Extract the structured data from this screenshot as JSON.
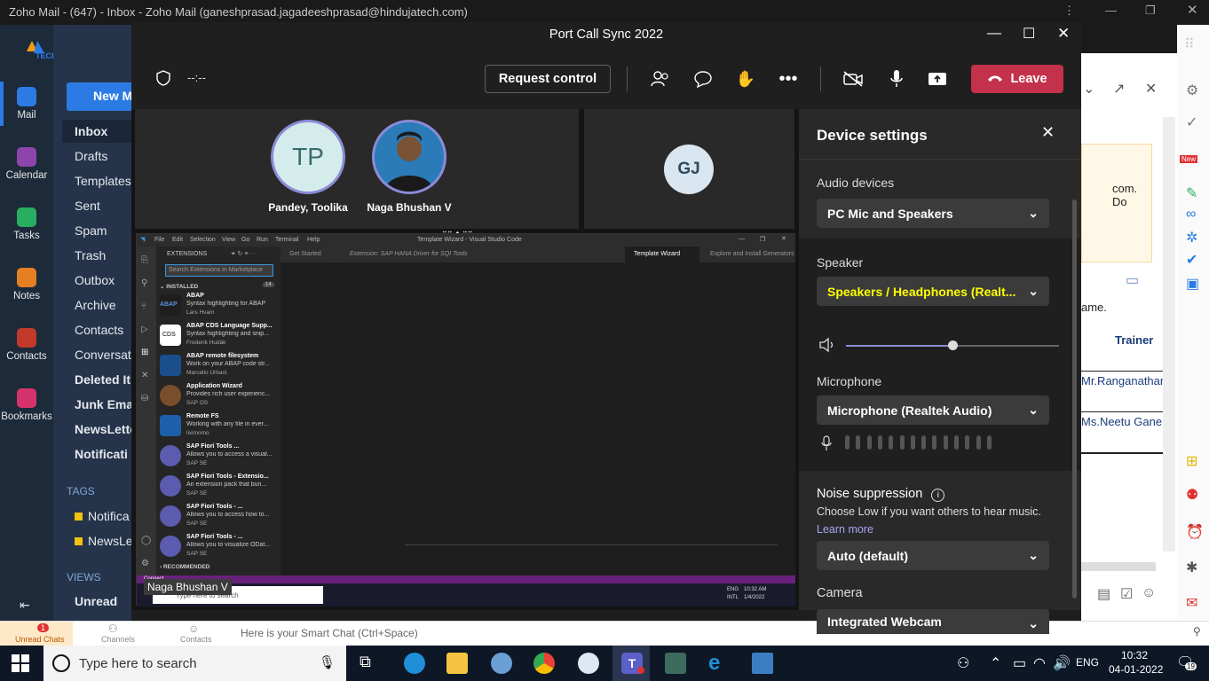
{
  "zoho": {
    "window_title": "Zoho Mail - (647) - Inbox - Zoho Mail (ganeshprasad.jagadeeshprasad@hindujatech.com)",
    "logo_text": "TECH",
    "rail": [
      "Mail",
      "Calendar",
      "Tasks",
      "Notes",
      "Contacts",
      "Bookmarks"
    ],
    "new_button": "New M",
    "folders": [
      "Inbox",
      "Drafts",
      "Templates",
      "Sent",
      "Spam",
      "Trash",
      "Outbox",
      "Archive",
      "Contacts",
      "Conversati",
      "Deleted It",
      "Junk Email",
      "NewsLette",
      "Notificati"
    ],
    "tags_header": "TAGS",
    "tags": [
      "Notifica",
      "NewsLe"
    ],
    "views_header": "VIEWS",
    "views": [
      "Unread"
    ],
    "reading_snippets": [
      "com. Do",
      "ame.",
      "Trainer",
      "Mr.Ranganathar",
      "Ms.Neetu Gane"
    ],
    "new_badge": "New",
    "bottom": {
      "chats": "Unread Chats",
      "chats_count": "1",
      "channels": "Channels",
      "contacts": "Contacts",
      "smart_chat": "Here is your Smart Chat (Ctrl+Space)"
    }
  },
  "teams": {
    "title": "Port Call Sync 2022",
    "timer": "--:--",
    "request_control": "Request control",
    "leave": "Leave",
    "participants": [
      {
        "initials": "TP",
        "name": "Pandey, Toolika"
      },
      {
        "initials": "",
        "name": "Naga Bhushan V"
      },
      {
        "initials": "GJ",
        "name": ""
      }
    ],
    "presenter_label": "Naga Bhushan V",
    "vscode": {
      "menu": [
        "File",
        "Edit",
        "Selection",
        "View",
        "Go",
        "Run",
        "Terminal",
        "Help"
      ],
      "window_title": "Template Wizard - Visual Studio Code",
      "tabs": [
        "Get Started",
        "Extension: SAP HANA Driver for SQI Tools",
        "Template Wizard",
        "Explore and Install Generators",
        "Release Notes: 1.63.2"
      ],
      "side_title": "EXTENSIONS",
      "search_placeholder": "Search Extensions in Marketplace",
      "installed": "INSTALLED",
      "installed_count": "14",
      "recommended": "RECOMMENDED",
      "extensions": [
        {
          "name": "ABAP",
          "desc": "Syntax highlighting for ABAP",
          "pub": "Lars Hvam"
        },
        {
          "name": "ABAP CDS Language Supp...",
          "desc": "Syntax highlighting and snip...",
          "pub": "Frederik Hudák"
        },
        {
          "name": "ABAP remote filesystem",
          "desc": "Work on your ABAP code str...",
          "pub": "Marcello Urbani"
        },
        {
          "name": "Application Wizard",
          "desc": "Provides rich user experienc...",
          "pub": "SAP OS"
        },
        {
          "name": "Remote FS",
          "desc": "Working with any file in ever...",
          "pub": "liximomo"
        },
        {
          "name": "SAP Fiori Tools ...",
          "desc": "Allows you to access a visual...",
          "pub": "SAP SE"
        },
        {
          "name": "SAP Fiori Tools - Extensio...",
          "desc": "An extension pack that bun...",
          "pub": "SAP SE"
        },
        {
          "name": "SAP Fiori Tools - ...",
          "desc": "Allows you to access how to...",
          "pub": "SAP SE"
        },
        {
          "name": "SAP Fiori Tools - ...",
          "desc": "Allows you to visualize ODat...",
          "pub": "SAP SE"
        }
      ],
      "status": "Connect",
      "inner_search": "Type here to search",
      "inner_tray": {
        "lang": "ENG",
        "lang2": "INTL",
        "time": "10:32 AM",
        "date": "1/4/2022"
      }
    },
    "device_settings": {
      "title": "Device settings",
      "audio_devices_label": "Audio devices",
      "audio_device": "PC Mic and Speakers",
      "speaker_label": "Speaker",
      "speaker": "Speakers / Headphones (Realt...",
      "speaker_volume": 0.5,
      "microphone_label": "Microphone",
      "microphone": "Microphone (Realtek Audio)",
      "noise_label": "Noise suppression",
      "noise_desc": "Choose Low if you want others to hear music.",
      "learn_more": "Learn more",
      "noise_value": "Auto (default)",
      "camera_label": "Camera",
      "camera": "Integrated Webcam",
      "accent": "#ffff00"
    }
  },
  "taskbar": {
    "search_placeholder": "Type here to search",
    "language": "ENG",
    "time": "10:32",
    "date": "04-01-2022",
    "notif_count": "19"
  }
}
